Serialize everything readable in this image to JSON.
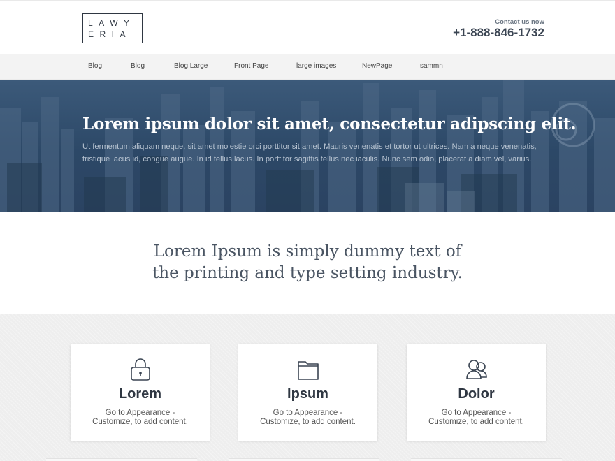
{
  "logo": {
    "line1": "LAWY",
    "line2": "ERIA"
  },
  "contact": {
    "label": "Contact us now",
    "phone": "+1-888-846-1732"
  },
  "nav": {
    "items": [
      "Blog",
      "Blog",
      "Blog Large",
      "Front Page",
      "large images",
      "NewPage",
      "sammn"
    ]
  },
  "hero": {
    "title": "Lorem ipsum dolor sit amet, consectetur adipscing elit.",
    "text": "Ut fermentum aliquam neque, sit amet molestie orci porttitor sit amet. Mauris venenatis et tortor ut ultrices. Nam a neque venenatis, tristique lacus id, congue augue. In id tellus lacus. In porttitor sagittis tellus nec iaculis. Nunc sem odio, placerat a diam vel, varius."
  },
  "tagline": {
    "line1": "Lorem Ipsum is simply dummy text of",
    "line2": "the printing and type setting industry."
  },
  "features": [
    {
      "title": "Lorem",
      "line1": "Go to Appearance -",
      "line2": "Customize, to add content.",
      "icon": "lock-icon"
    },
    {
      "title": "Ipsum",
      "line1": "Go to Appearance -",
      "line2": "Customize, to add content.",
      "icon": "folder-icon"
    },
    {
      "title": "Dolor",
      "line1": "Go to Appearance -",
      "line2": "Customize, to add content.",
      "icon": "users-icon"
    }
  ],
  "colors": {
    "hero": "#2c4867",
    "text_dark": "#2f3742",
    "nav_bg": "#f3f3f3",
    "features_bg": "#eeeeee"
  }
}
